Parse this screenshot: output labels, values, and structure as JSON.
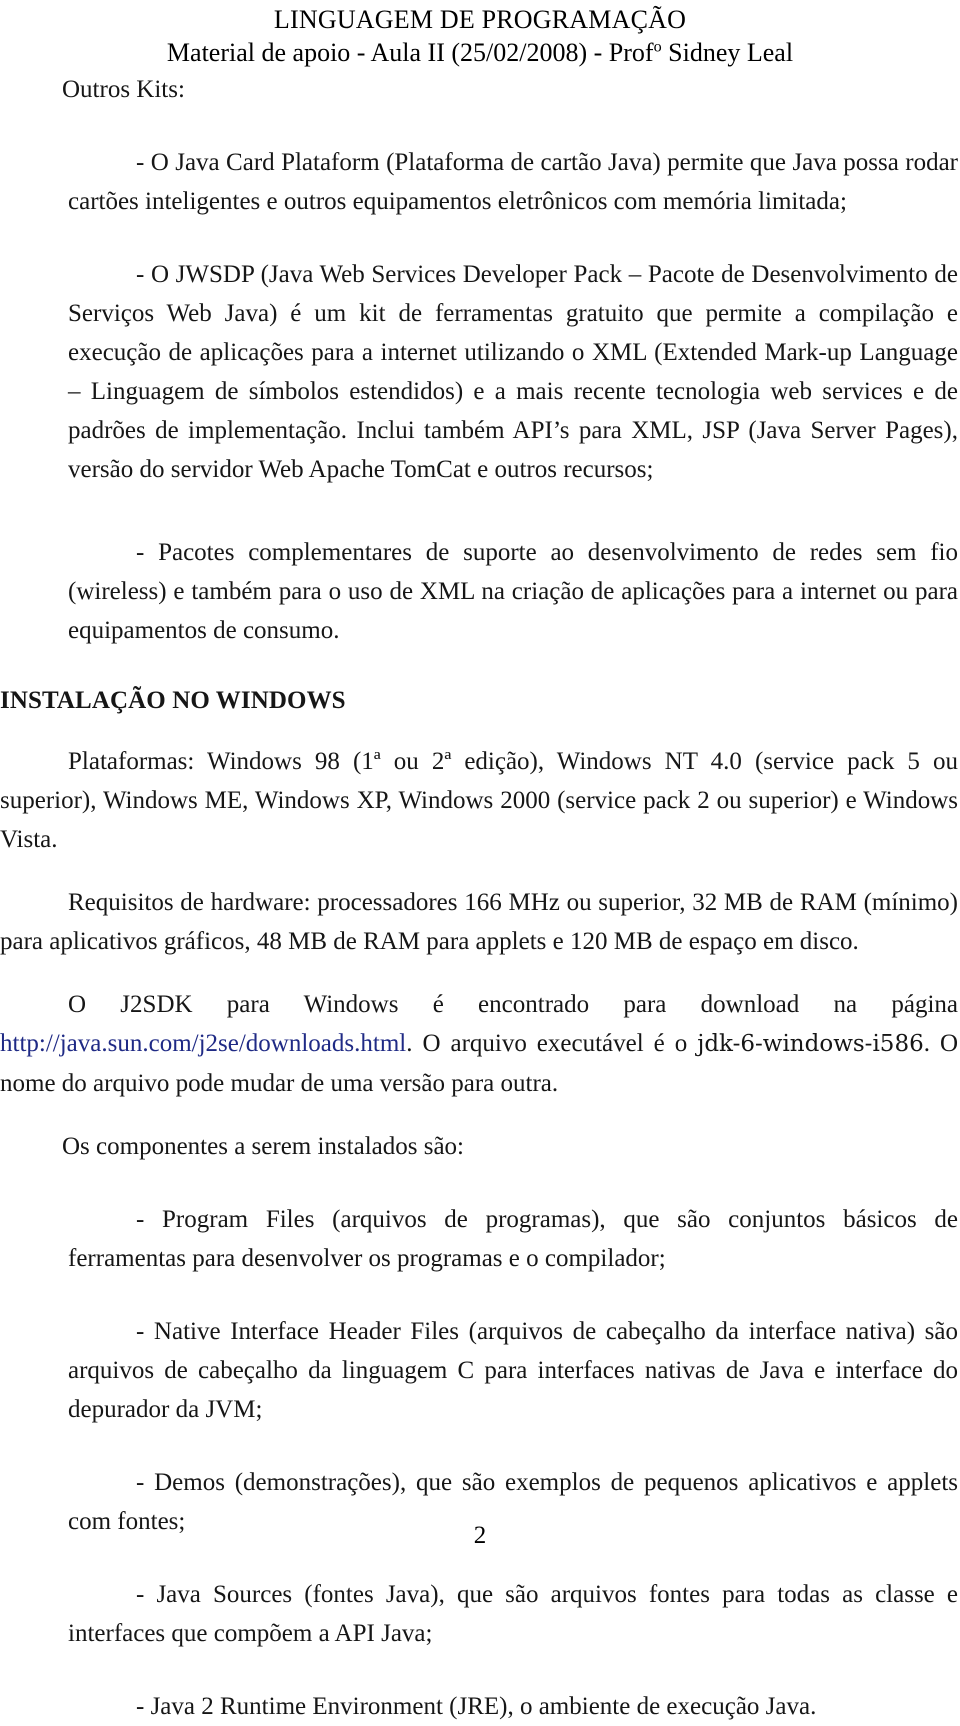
{
  "document": {
    "header": {
      "title": "LINGUAGEM DE PROGRAMAÇÃO",
      "subtitle_before_sup": "Material de apoio - Aula II (25/02/2008) - Prof",
      "subtitle_sup": "o",
      "subtitle_after_sup": " Sidney Leal"
    },
    "section_label": "Outros Kits:",
    "paragraphs": {
      "java_card": "- O Java Card Plataform (Plataforma de cartão Java) permite que Java possa rodar cartões inteligentes e outros equipamentos eletrônicos com memória limitada;",
      "jwsdp": "- O JWSDP (Java Web Services Developer Pack – Pacote de Desenvolvimento de Serviços Web Java) é um kit de ferramentas gratuito que permite a compilação e execução de aplicações para a internet utilizando o XML (Extended Mark-up Language – Linguagem de símbolos estendidos) e a mais recente tecnologia web services e de padrões de implementação. Inclui também API’s para XML, JSP (Java Server Pages), versão do servidor Web Apache TomCat e outros recursos;",
      "pacotes": "- Pacotes complementares de suporte ao desenvolvimento de redes sem fio (wireless) e também para o uso de XML na criação de aplicações para a internet ou para equipamentos de consumo."
    },
    "install_section": {
      "heading": "INSTALAÇÃO NO WINDOWS",
      "platforms": "Plataformas: Windows 98 (1ª ou 2ª edição), Windows NT 4.0 (service pack 5 ou superior), Windows ME, Windows XP, Windows 2000 (service pack 2 ou superior) e Windows Vista.",
      "hardware": "Requisitos de hardware: processadores 166 MHz ou superior, 32 MB de RAM (mínimo) para aplicativos gráficos, 48 MB de RAM para applets e 120 MB de espaço em disco.",
      "download_lead": "O J2SDK para Windows é encontrado para download na página ",
      "download_url": "http://java.sun.com/j2se/downloads.html",
      "download_mid": ". O arquivo executável é o ",
      "download_filename": "jdk-6-windows-i586",
      "download_tail": ". O nome do arquivo pode mudar de uma versão para outra.",
      "components_lead": "Os componentes a serem instalados são:",
      "components": [
        "- Program Files (arquivos de programas), que são conjuntos básicos de ferramentas para desenvolver os programas e o compilador;",
        "- Native Interface Header Files (arquivos de cabeçalho da interface nativa) são arquivos de cabeçalho da linguagem C para interfaces nativas de Java e interface do depurador da JVM;",
        "- Demos (demonstrações), que são exemplos de pequenos aplicativos e applets com fontes;",
        "- Java Sources (fontes Java), que são arquivos fontes para todas as classe e interfaces que compõem a API Java;",
        "- Java 2 Runtime Environment (JRE), o ambiente de execução Java."
      ]
    },
    "footer": {
      "page_number": "2"
    },
    "colors": {
      "text": "#161616",
      "link": "#1f2a85",
      "background": "#ffffff"
    }
  }
}
